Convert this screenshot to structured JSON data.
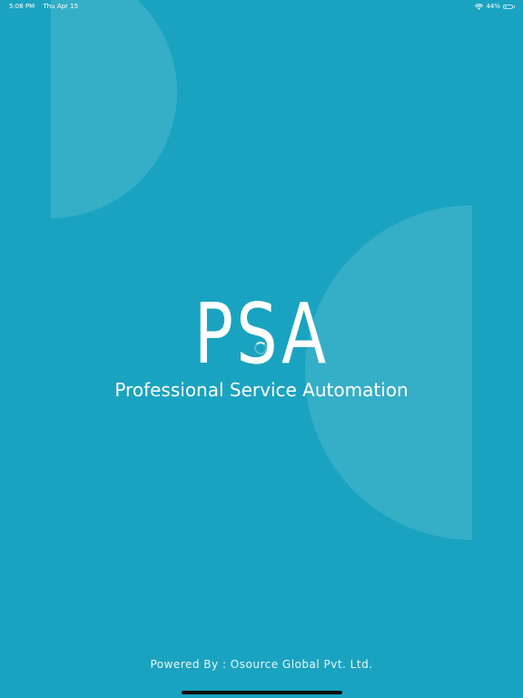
{
  "status_bar": {
    "time": "5:08 PM",
    "date": "Thu Apr 15",
    "battery": "44%",
    "battery_level": 0.44
  },
  "splash": {
    "title": "PSA",
    "tagline": "Professional Service Automation",
    "footer": "Powered By : Osource Global Pvt. Ltd."
  },
  "colors": {
    "background": "#1aa3c0",
    "text": "#ffffff"
  },
  "icons": [
    "wifi-icon",
    "battery-icon",
    "loading-spinner-icon"
  ]
}
